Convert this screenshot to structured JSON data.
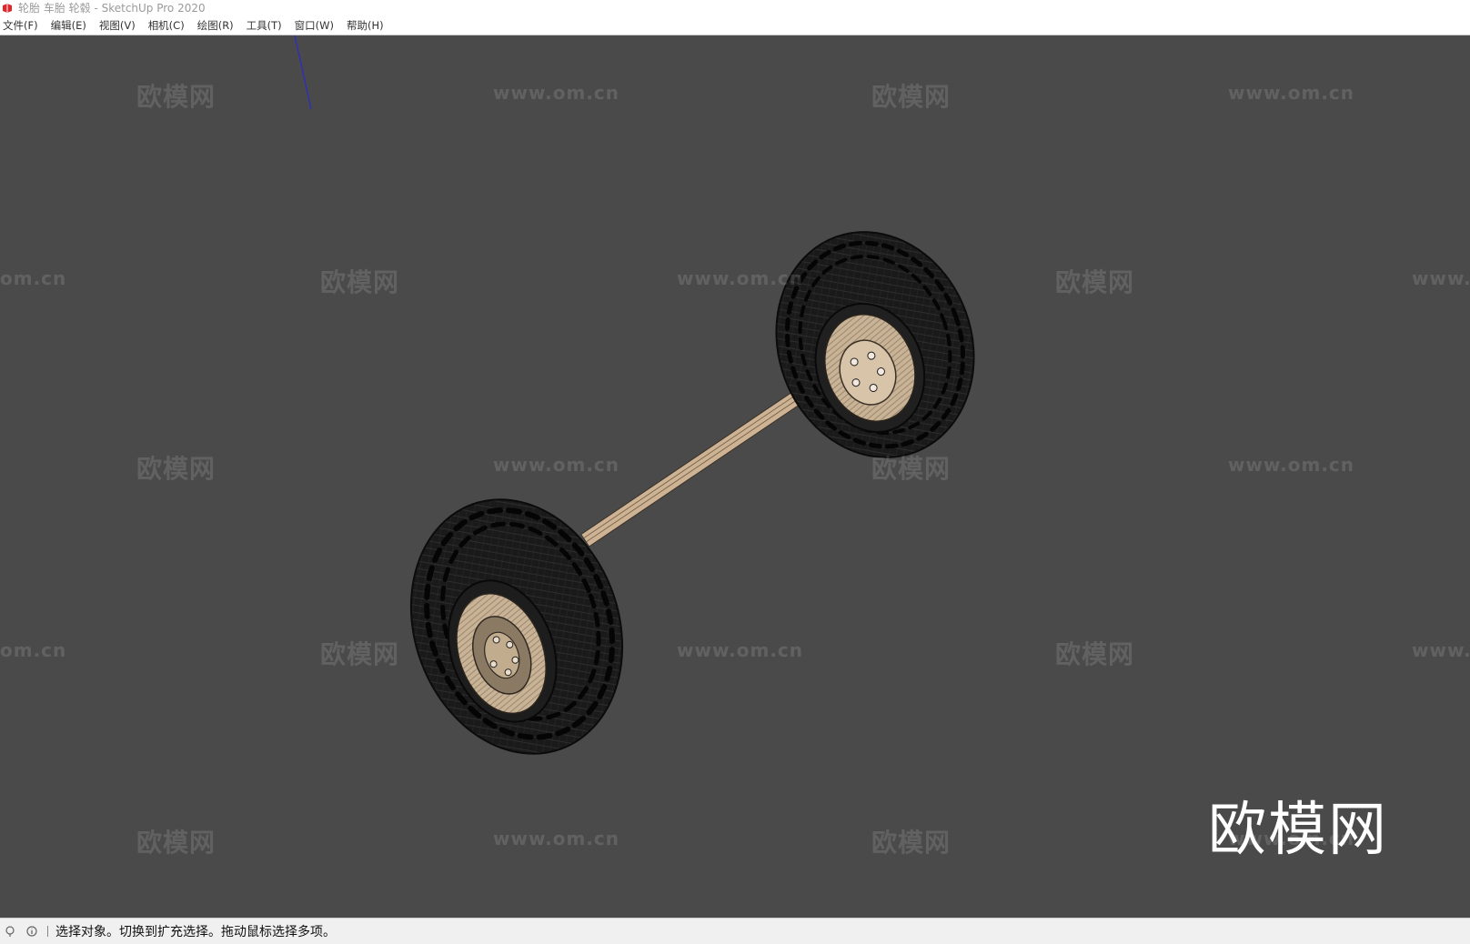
{
  "window": {
    "title": "轮胎 车胎 轮毂 - SketchUp Pro 2020"
  },
  "menu": {
    "items": [
      {
        "label": "文件(F)"
      },
      {
        "label": "编辑(E)"
      },
      {
        "label": "视图(V)"
      },
      {
        "label": "相机(C)"
      },
      {
        "label": "绘图(R)"
      },
      {
        "label": "工具(T)"
      },
      {
        "label": "窗口(W)"
      },
      {
        "label": "帮助(H)"
      }
    ]
  },
  "watermarks": {
    "brand": "欧模网",
    "url": "www.om.cn",
    "url_partial_left": "om.cn",
    "url_partial_right": "www."
  },
  "status": {
    "text": "选择对象。切换到扩充选择。拖动鼠标选择多项。"
  },
  "colors": {
    "viewport_bg": "#4a4a4a",
    "rim": "#c9b396",
    "axle": "#cdb393",
    "tire": "#161616",
    "axis_blue": "#2a2ad0"
  }
}
